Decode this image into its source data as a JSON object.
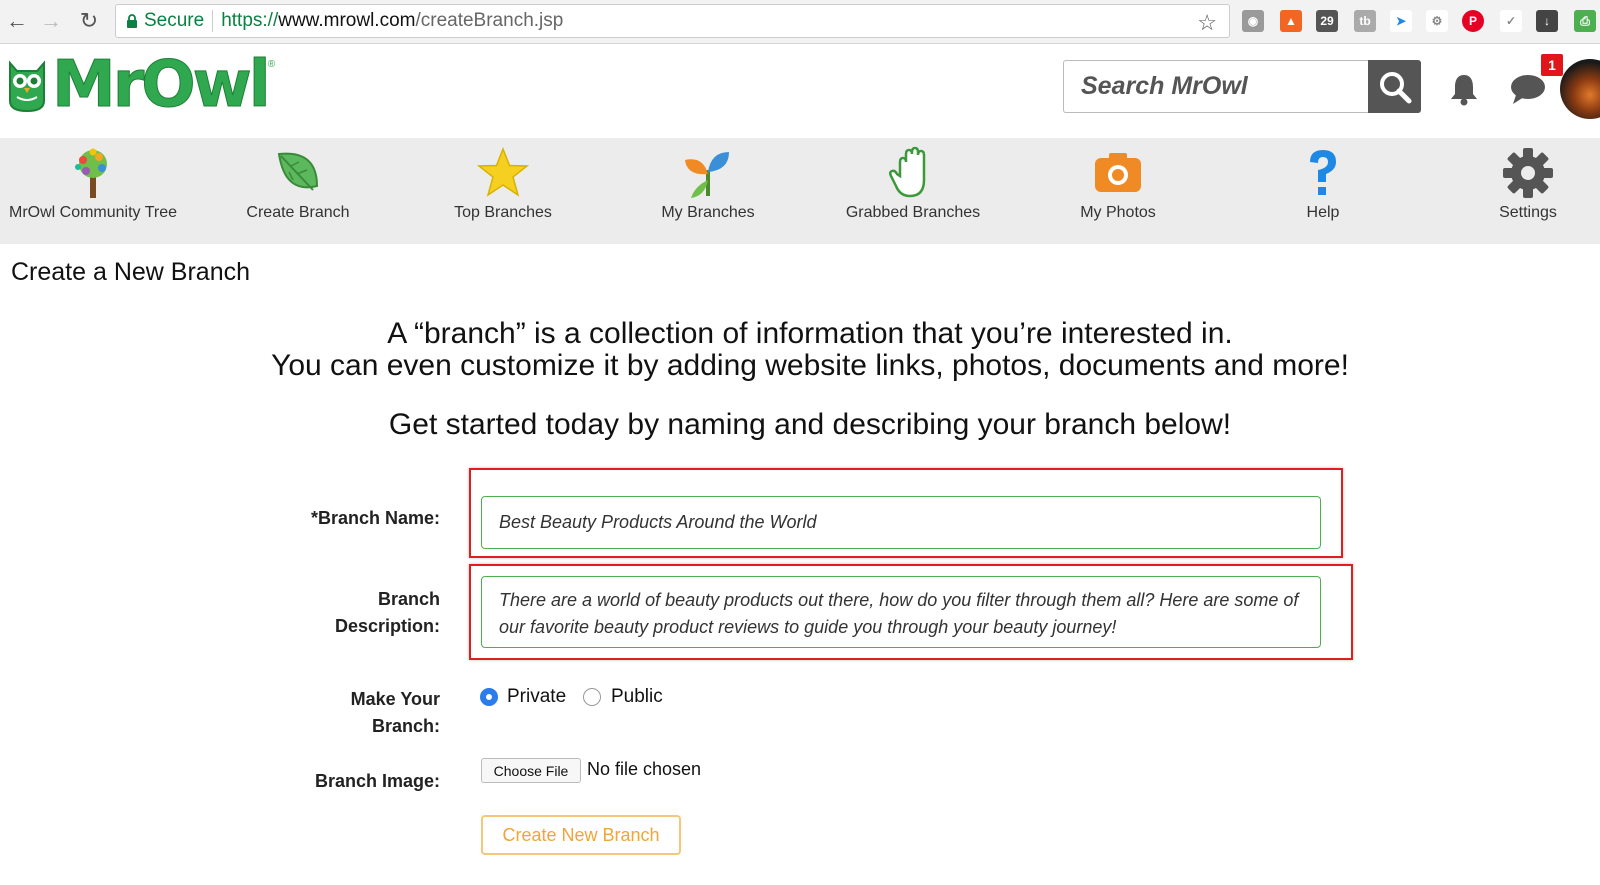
{
  "browser": {
    "secure_label": "Secure",
    "url_scheme": "https://",
    "url_host": "www.mrowl.com",
    "url_path": "/createBranch.jsp"
  },
  "header": {
    "logo_text": "MrOwl",
    "logo_reg": "®",
    "search_placeholder": "Search MrOwl",
    "notification_count": "1"
  },
  "nav": {
    "items": [
      {
        "label": "MrOwl Community Tree",
        "icon": "tree-icon"
      },
      {
        "label": "Create Branch",
        "icon": "leaf-icon"
      },
      {
        "label": "Top Branches",
        "icon": "star-icon"
      },
      {
        "label": "My Branches",
        "icon": "sprout-icon"
      },
      {
        "label": "Grabbed Branches",
        "icon": "hand-icon"
      },
      {
        "label": "My Photos",
        "icon": "camera-icon"
      },
      {
        "label": "Help",
        "icon": "question-icon"
      },
      {
        "label": "Settings",
        "icon": "gear-icon"
      }
    ]
  },
  "page": {
    "title": "Create a New Branch",
    "intro_line1": "A “branch” is a collection of information that you’re interested in.",
    "intro_line2": "You can even customize it by adding website links, photos, documents and more!",
    "intro_line3": "Get started today by naming and describing your branch below!"
  },
  "form": {
    "name_label": "*Branch Name:",
    "name_value": "Best Beauty Products Around the World",
    "desc_label_1": "Branch",
    "desc_label_2": "Description:",
    "desc_value": "There are a world of beauty products out there, how do you filter through them all? Here are some of our favorite beauty product reviews to guide you through your beauty journey!",
    "privacy_label_1": "Make Your",
    "privacy_label_2": "Branch:",
    "private_label": "Private",
    "public_label": "Public",
    "selected_privacy": "Private",
    "image_label": "Branch Image:",
    "choose_file_label": "Choose File",
    "no_file_label": "No file chosen",
    "submit_label": "Create New Branch"
  },
  "colors": {
    "brand_green": "#2fa84f",
    "highlight_red": "#e01e1e",
    "button_orange": "#f0a53a"
  }
}
